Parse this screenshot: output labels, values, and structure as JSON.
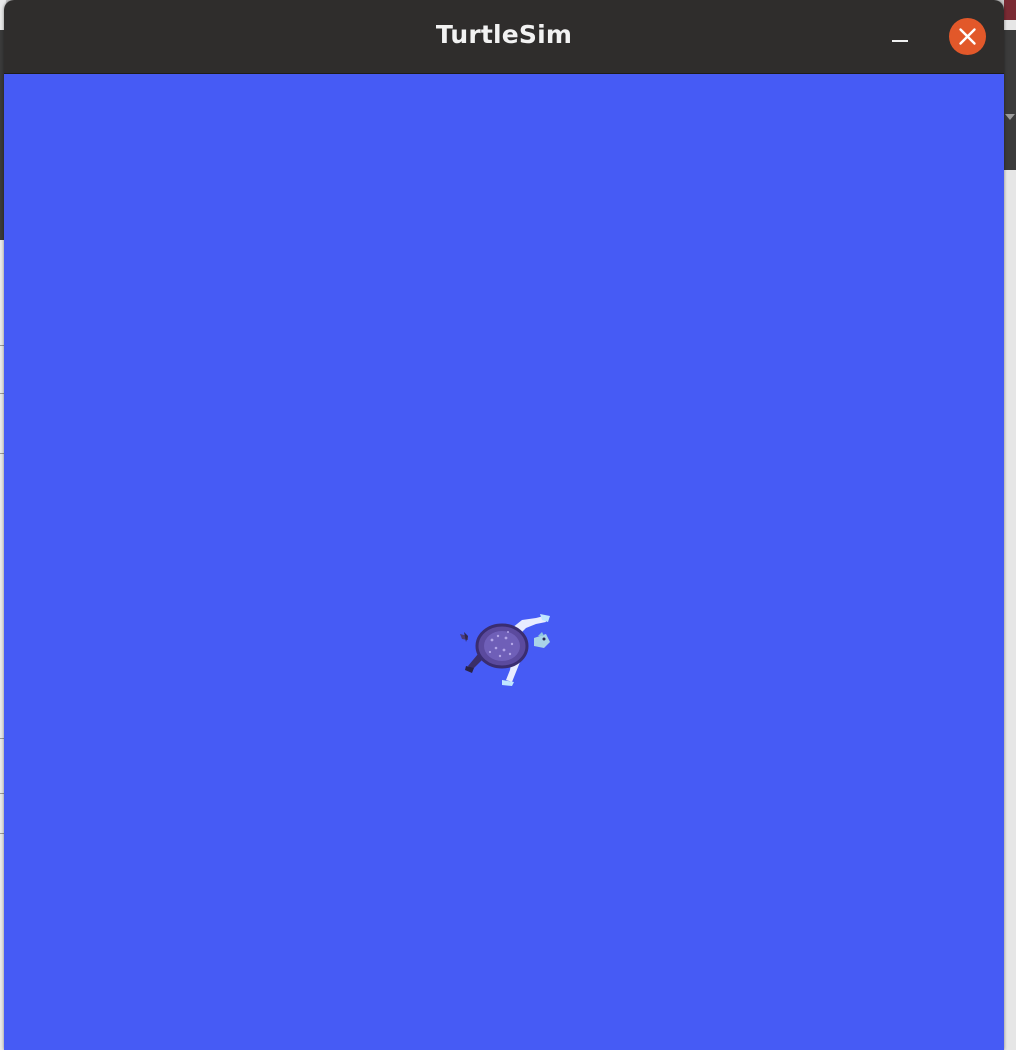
{
  "window": {
    "title": "TurtleSim",
    "controls": {
      "minimize_icon": "minimize-icon",
      "close_icon": "close-icon"
    }
  },
  "canvas": {
    "background_color": "#465bf5",
    "turtle_icon": "turtle-icon"
  },
  "colors": {
    "titlebar": "#2f2d2c",
    "close_button": "#e2582a",
    "title_text": "#f2f2f2"
  }
}
